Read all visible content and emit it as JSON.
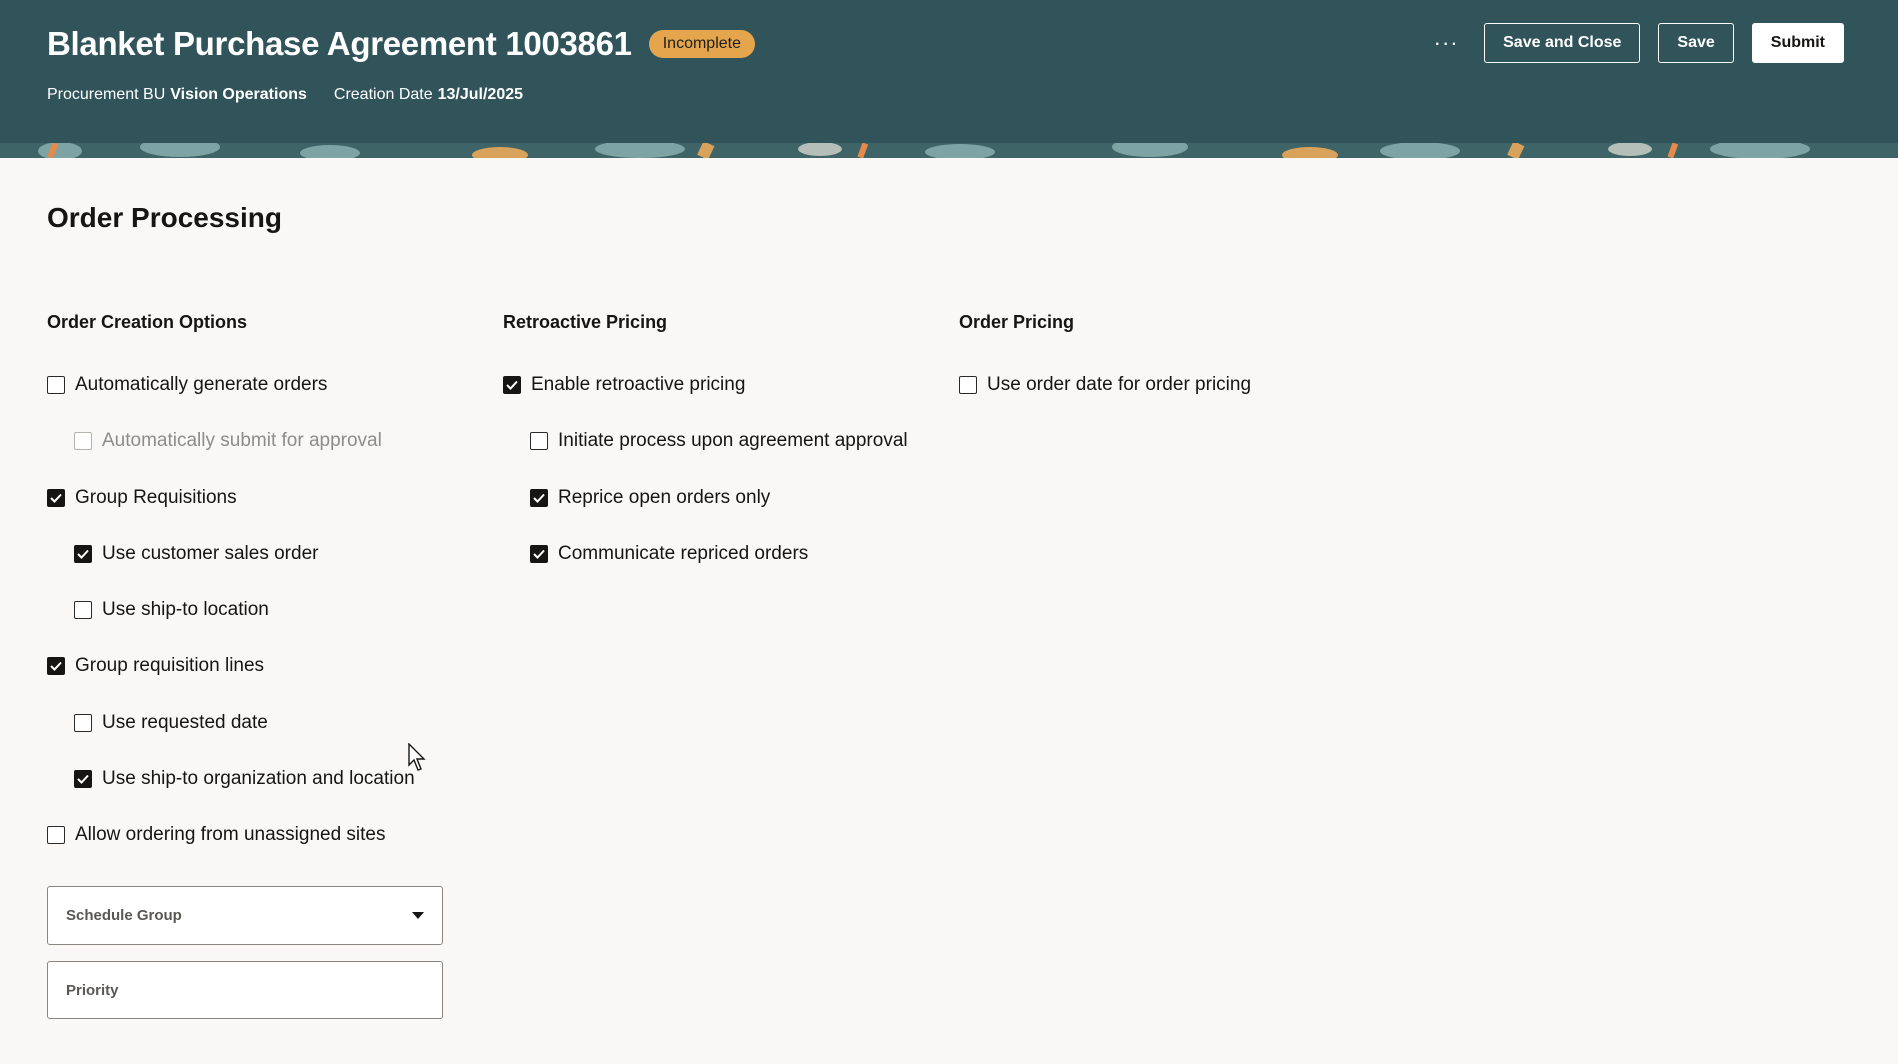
{
  "header": {
    "title": "Blanket Purchase Agreement 1003861",
    "status": "Incomplete",
    "procurement_bu_label": "Procurement BU",
    "procurement_bu_value": "Vision Operations",
    "creation_date_label": "Creation Date",
    "creation_date_value": "13/Jul/2025",
    "more_label": "···",
    "save_close_label": "Save and Close",
    "save_label": "Save",
    "submit_label": "Submit"
  },
  "section": {
    "title": "Order Processing"
  },
  "order_creation": {
    "title": "Order Creation Options",
    "options": [
      {
        "label": "Automatically generate orders",
        "checked": false
      },
      {
        "label": "Automatically submit for approval",
        "checked": false,
        "disabled": true
      },
      {
        "label": "Group Requisitions",
        "checked": true
      },
      {
        "label": "Use customer sales order",
        "checked": true
      },
      {
        "label": "Use ship-to location",
        "checked": false
      },
      {
        "label": "Group requisition lines",
        "checked": true
      },
      {
        "label": "Use requested date",
        "checked": false
      },
      {
        "label": "Use ship-to organization and location",
        "checked": true
      },
      {
        "label": "Allow ordering from unassigned sites",
        "checked": false
      }
    ]
  },
  "retroactive": {
    "title": "Retroactive Pricing",
    "options": [
      {
        "label": "Enable retroactive pricing",
        "checked": true
      },
      {
        "label": "Initiate process upon agreement approval",
        "checked": false
      },
      {
        "label": "Reprice open orders only",
        "checked": true
      },
      {
        "label": "Communicate repriced orders",
        "checked": true
      }
    ]
  },
  "order_pricing": {
    "title": "Order Pricing",
    "options": [
      {
        "label": "Use order date for order pricing",
        "checked": false
      }
    ]
  },
  "fields": {
    "schedule_group_label": "Schedule Group",
    "priority_label": "Priority"
  },
  "colors": {
    "header_bg": "#31545b",
    "badge_bg": "#e5a54d"
  }
}
